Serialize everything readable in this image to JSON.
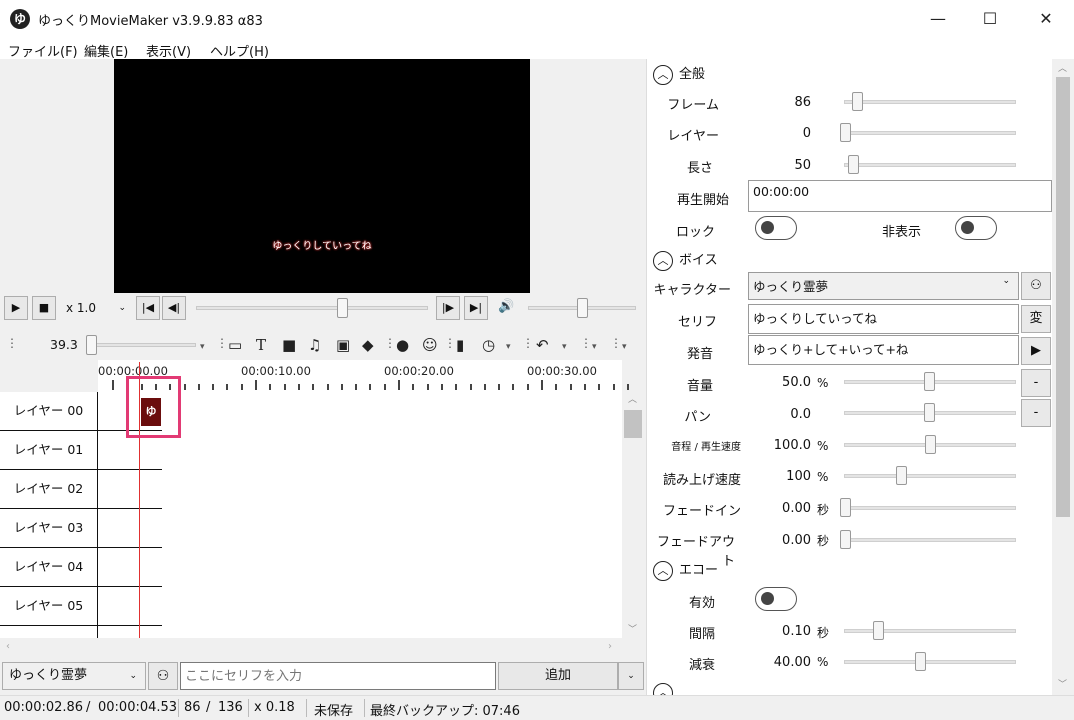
{
  "window": {
    "title": "ゆっくりMovieMaker v3.9.9.83 α83",
    "app_icon_glyph": "ゆ",
    "minimize": "—",
    "maximize": "☐",
    "close": "✕"
  },
  "menu": [
    "ファイル(F)",
    "編集(E)",
    "表示(V)",
    "ヘルプ(H)"
  ],
  "preview": {
    "subtitle": "ゆっくりしていってね"
  },
  "player": {
    "play_icon": "▶",
    "stop_icon": "■",
    "speed": "x 1.0",
    "first_icon": "|◀",
    "prev_icon": "◀|",
    "next_icon": "|▶",
    "last_icon": "▶|",
    "volume_icon": "🔊",
    "seek_position": 0.63,
    "volume_position": 0.5
  },
  "timeline_toolbar": {
    "zoom_value": "39.3",
    "icons": [
      "comment-icon",
      "text-icon",
      "video-icon",
      "music-icon",
      "image-icon",
      "shapes-icon",
      "person-icon",
      "face-icon",
      "book-icon",
      "clock-icon",
      "undo-icon"
    ]
  },
  "timeline": {
    "ruler": [
      "00:00:00.00",
      "00:00:10.00",
      "00:00:20.00",
      "00:00:30.00"
    ],
    "layers": [
      "レイヤー 00",
      "レイヤー 01",
      "レイヤー 02",
      "レイヤー 03",
      "レイヤー 04",
      "レイヤー 05"
    ],
    "clip_label": "ゆっ"
  },
  "input_row": {
    "character": "ゆっくり霊夢",
    "placeholder": "ここにセリフを入力",
    "add_label": "追加"
  },
  "status": {
    "time": "00:00:02.86",
    "time_sep": "/",
    "duration": "00:00:04.53",
    "frame": "86",
    "frame_sep": "/",
    "total_frames": "136",
    "zoom": "x 0.18",
    "save_state": "未保存",
    "backup": "最終バックアップ: 07:46"
  },
  "properties": {
    "general": {
      "title": "全般",
      "frame_label": "フレーム",
      "frame_value": "86",
      "layer_label": "レイヤー",
      "layer_value": "0",
      "length_label": "長さ",
      "length_value": "50",
      "start_label": "再生開始",
      "start_value": "00:00:00",
      "lock_label": "ロック",
      "hide_label": "非表示"
    },
    "voice": {
      "title": "ボイス",
      "character_label": "キャラクター",
      "character_value": "ゆっくり霊夢",
      "line_label": "セリフ",
      "line_value": "ゆっくりしていってね",
      "pron_label": "発音",
      "pron_value": "ゆっくり+して+いって+ね",
      "volume_label": "音量",
      "volume_value": "50.0",
      "volume_unit": "%",
      "pan_label": "パン",
      "pan_value": "0.0",
      "pitch_label": "音程 / 再生速度",
      "pitch_value": "100.0",
      "pitch_unit": "%",
      "speed_label": "読み上げ速度",
      "speed_value": "100",
      "speed_unit": "%",
      "fadein_label": "フェードイン",
      "fadein_value": "0.00",
      "fadein_unit": "秒",
      "fadeout_label": "フェードアウト",
      "fadeout_value": "0.00",
      "fadeout_unit": "秒",
      "change_btn": "変",
      "play_btn": "▶",
      "minus1": "-",
      "minus2": "-"
    },
    "echo": {
      "title": "エコー",
      "enabled_label": "有効",
      "interval_label": "間隔",
      "interval_value": "0.10",
      "interval_unit": "秒",
      "decay_label": "減衰",
      "decay_value": "40.00",
      "decay_unit": "%"
    }
  }
}
